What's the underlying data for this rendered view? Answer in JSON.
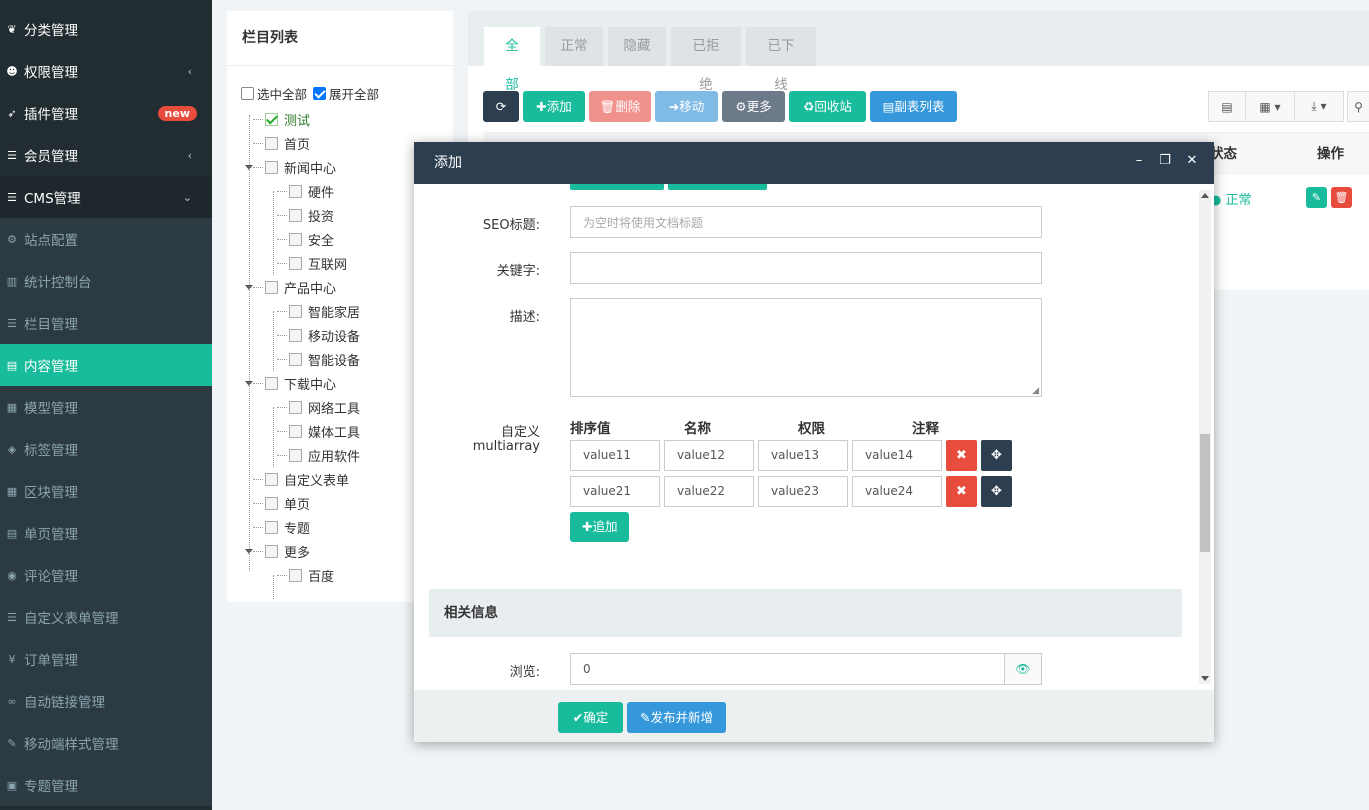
{
  "sidebar": {
    "items": [
      {
        "label": "分类管理",
        "icon": "leaf-icon",
        "icon_char": "❦"
      },
      {
        "label": "权限管理",
        "icon": "users-icon",
        "icon_char": "☻",
        "arrow": "‹"
      },
      {
        "label": "插件管理",
        "icon": "rocket-icon",
        "icon_char": "➶",
        "badge": "new"
      },
      {
        "label": "会员管理",
        "icon": "list-icon",
        "icon_char": "☰",
        "arrow": "‹"
      },
      {
        "label": "CMS管理",
        "icon": "list-icon",
        "icon_char": "☰",
        "arrow": "⌄"
      },
      {
        "label": "站点配置",
        "icon": "gears-icon",
        "icon_char": "⚙"
      },
      {
        "label": "统计控制台",
        "icon": "bar-chart-icon",
        "icon_char": "▥"
      },
      {
        "label": "栏目管理",
        "icon": "list-icon",
        "icon_char": "☰"
      },
      {
        "label": "内容管理",
        "icon": "file-icon",
        "icon_char": "▤"
      },
      {
        "label": "模型管理",
        "icon": "grid-icon",
        "icon_char": "▦"
      },
      {
        "label": "标签管理",
        "icon": "tags-icon",
        "icon_char": "◈"
      },
      {
        "label": "区块管理",
        "icon": "blocks-icon",
        "icon_char": "▦"
      },
      {
        "label": "单页管理",
        "icon": "file-icon",
        "icon_char": "▤"
      },
      {
        "label": "评论管理",
        "icon": "comment-icon",
        "icon_char": "◉"
      },
      {
        "label": "自定义表单管理",
        "icon": "list-icon",
        "icon_char": "☰"
      },
      {
        "label": "订单管理",
        "icon": "yen-icon",
        "icon_char": "¥"
      },
      {
        "label": "自动链接管理",
        "icon": "link-icon",
        "icon_char": "∞"
      },
      {
        "label": "移动端样式管理",
        "icon": "magic-icon",
        "icon_char": "✎"
      },
      {
        "label": "专题管理",
        "icon": "newspaper-icon",
        "icon_char": "▣"
      }
    ]
  },
  "category_panel": {
    "title": "栏目列表",
    "select_all": "选中全部",
    "expand_all": "展开全部",
    "nodes": [
      "测试",
      "首页",
      "新闻中心",
      "硬件",
      "投资",
      "安全",
      "互联网",
      "产品中心",
      "智能家居",
      "移动设备",
      "智能设备",
      "下载中心",
      "网络工具",
      "媒体工具",
      "应用软件",
      "自定义表单",
      "单页",
      "专题",
      "更多",
      "百度"
    ]
  },
  "main": {
    "tabs": [
      "全部",
      "正常",
      "隐藏",
      "已拒绝",
      "已下线"
    ],
    "toolbar": {
      "refresh": "⟳",
      "add": "✚添加",
      "delete": "🗑删除",
      "move": "➜移动",
      "more": "⚙更多",
      "recycle": "♻回收站",
      "sublist": "▤副表列表"
    },
    "columns": {
      "status": "状态",
      "action": "操作"
    },
    "row": {
      "status": "● 正常"
    }
  },
  "modal": {
    "title": "添加",
    "controls": {
      "minimize": "–",
      "maximize": "❐",
      "close": "✕"
    },
    "fields": {
      "seo_title_label": "SEO标题:",
      "seo_title_placeholder": "为空时将使用文档标题",
      "keywords_label": "关键字:",
      "description_label": "描述:",
      "multiarray_label_1": "自定义",
      "multiarray_label_2": "multiarray"
    },
    "multiarray": {
      "headers": [
        "排序值",
        "名称",
        "权限",
        "注释"
      ],
      "rows": [
        [
          "value11",
          "value12",
          "value13",
          "value14"
        ],
        [
          "value21",
          "value22",
          "value23",
          "value24"
        ]
      ],
      "append": "✚追加"
    },
    "section": "相关信息",
    "views_label": "浏览:",
    "views_value": "0",
    "footer": {
      "confirm": "✔确定",
      "publish_new": "✎发布并新增"
    }
  },
  "colors": {
    "accent": "#18bc9c",
    "danger": "#e74c3c",
    "dark": "#2c3e50",
    "sidebar": "#222d32"
  }
}
